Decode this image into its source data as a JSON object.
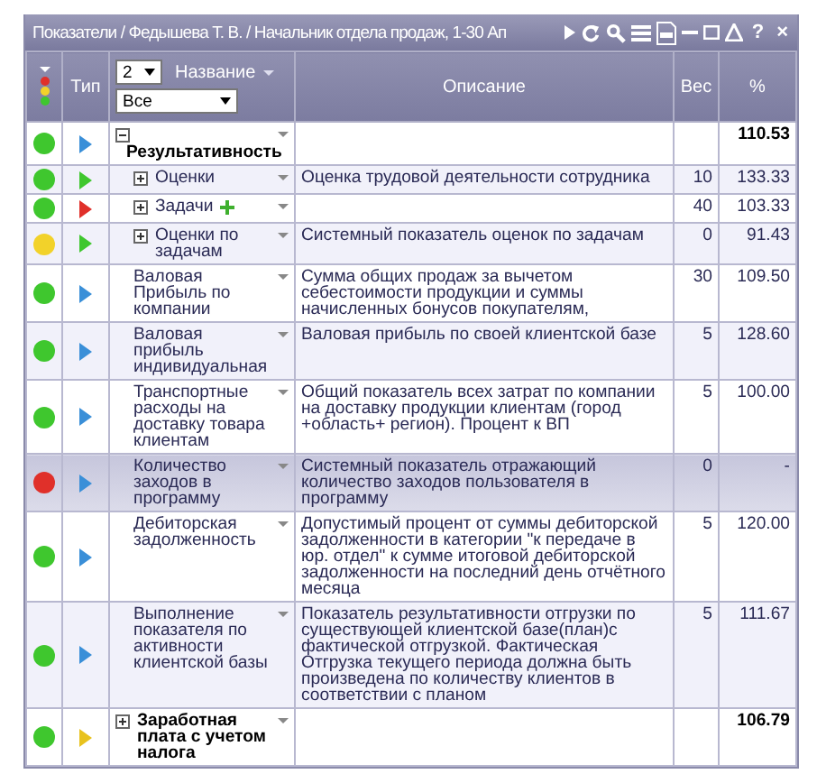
{
  "window": {
    "title": "Показатели / Федышева Т. В. / Начальник отдела продаж, 1-30 Ап",
    "help": "?",
    "close": "×"
  },
  "header": {
    "type": "Тип",
    "level_select": "2",
    "name": "Название",
    "filter_select": "Все",
    "description": "Описание",
    "weight": "Вес",
    "percent": "%"
  },
  "rows": [
    {
      "status": {
        "color": "#3fc72e"
      },
      "arrow": {
        "color": "#3a8fd8"
      },
      "expanded": true,
      "name": "Результативность",
      "star": false,
      "percent": "110.53",
      "selected": false,
      "children": [
        {
          "status": {
            "color": "#3fc72e"
          },
          "arrow": {
            "color": "#3fc72e"
          },
          "expanded": false,
          "name": "Оценки",
          "star": false,
          "description": "Оценка трудовой деятельности сотрудника",
          "weight": "10",
          "percent": "133.33",
          "selected": false
        },
        {
          "status": {
            "color": "#3fc72e"
          },
          "arrow": {
            "color": "#e0302a"
          },
          "expanded": false,
          "name": "Задачи",
          "star": true,
          "weight": "40",
          "percent": "103.33",
          "selected": false
        },
        {
          "status": {
            "color": "#f2d22a"
          },
          "arrow": {
            "color": "#3fc72e"
          },
          "expanded": false,
          "name": "Оценки по задачам",
          "star": false,
          "description": "Системный показатель оценок по задачам",
          "weight": "0",
          "percent": "91.43",
          "selected": false
        },
        {
          "status": {
            "color": "#3fc72e"
          },
          "arrow": {
            "color": "#3a8fd8"
          },
          "name": "Валовая Прибыль по компании",
          "star": false,
          "description": "Сумма общих продаж за вычетом себестоимости продукции и суммы начисленных бонусов покупателям,",
          "weight": "30",
          "percent": "109.50",
          "selected": false
        },
        {
          "status": {
            "color": "#3fc72e"
          },
          "arrow": {
            "color": "#3a8fd8"
          },
          "name": "Валовая прибыль индивидуальная",
          "star": false,
          "description": "Валовая прибыль по своей клиентской базе",
          "weight": "5",
          "percent": "128.60",
          "selected": false
        },
        {
          "status": {
            "color": "#3fc72e"
          },
          "arrow": {
            "color": "#3a8fd8"
          },
          "name": "Транспортные расходы на доставку товара клиентам",
          "star": false,
          "description": "Общий показатель всех затрат по компании на доставку продукции клиентам (город +область+ регион). Процент к ВП",
          "weight": "5",
          "percent": "100.00",
          "selected": false
        },
        {
          "status": {
            "color": "#e0302a"
          },
          "arrow": {
            "color": "#3a8fd8"
          },
          "name": "Количество заходов в программу",
          "star": false,
          "description": "Системный показатель отражающий количество заходов пользователя в программу",
          "weight": "0",
          "percent": "-",
          "selected": true
        },
        {
          "status": {
            "color": "#3fc72e"
          },
          "arrow": {
            "color": "#3a8fd8"
          },
          "name": "Дебиторская задолженность",
          "star": false,
          "description": "Допустимый процент от суммы дебиторской задолженности в категории \"к передаче в юр. отдел\" к сумме итоговой дебиторской задолженности на последний день отчётного месяца",
          "weight": "5",
          "percent": "120.00",
          "selected": false
        },
        {
          "status": {
            "color": "#3fc72e"
          },
          "arrow": {
            "color": "#3a8fd8"
          },
          "name": "Выполнение показателя по активности клиентской базы",
          "star": false,
          "description": "Показатель результативности отгрузки по существующей клиентской базе(план)с фактической отгрузкой. Фактическая Отгрузка текущего периода должна быть произведена по количеству клиентов в соответствии с планом",
          "weight": "5",
          "percent": "111.67",
          "selected": false
        }
      ]
    },
    {
      "status": {
        "color": "#3fc72e"
      },
      "arrow": {
        "color": "#e8c21e"
      },
      "expanded": false,
      "name": "Заработная плата с учетом налога",
      "star": false,
      "percent": "106.79",
      "selected": false
    }
  ]
}
